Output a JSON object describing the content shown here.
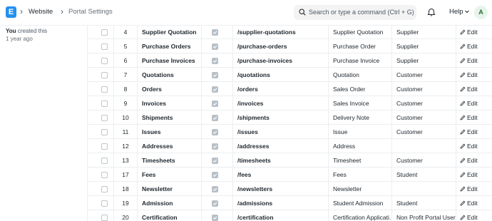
{
  "app": {
    "logo_letter": "E"
  },
  "breadcrumb": {
    "items": [
      "Website",
      "Portal Settings"
    ]
  },
  "search": {
    "placeholder": "Search or type a command (Ctrl + G)"
  },
  "header": {
    "help_label": "Help",
    "avatar_initial": "A"
  },
  "sidebar": {
    "actor": "You",
    "activity": "created this",
    "time": "1 year ago"
  },
  "table": {
    "edit_label": "Edit",
    "rows": [
      {
        "idx": "4",
        "title": "Supplier Quotation",
        "enabled": true,
        "route": "/supplier-quotations",
        "reference_doctype": "Supplier Quotation",
        "role": "Supplier"
      },
      {
        "idx": "5",
        "title": "Purchase Orders",
        "enabled": true,
        "route": "/purchase-orders",
        "reference_doctype": "Purchase Order",
        "role": "Supplier"
      },
      {
        "idx": "6",
        "title": "Purchase Invoices",
        "enabled": true,
        "route": "/purchase-invoices",
        "reference_doctype": "Purchase Invoice",
        "role": "Supplier"
      },
      {
        "idx": "7",
        "title": "Quotations",
        "enabled": true,
        "route": "/quotations",
        "reference_doctype": "Quotation",
        "role": "Customer"
      },
      {
        "idx": "8",
        "title": "Orders",
        "enabled": true,
        "route": "/orders",
        "reference_doctype": "Sales Order",
        "role": "Customer"
      },
      {
        "idx": "9",
        "title": "Invoices",
        "enabled": true,
        "route": "/invoices",
        "reference_doctype": "Sales Invoice",
        "role": "Customer"
      },
      {
        "idx": "10",
        "title": "Shipments",
        "enabled": true,
        "route": "/shipments",
        "reference_doctype": "Delivery Note",
        "role": "Customer"
      },
      {
        "idx": "11",
        "title": "Issues",
        "enabled": true,
        "route": "/issues",
        "reference_doctype": "Issue",
        "role": "Customer"
      },
      {
        "idx": "12",
        "title": "Addresses",
        "enabled": true,
        "route": "/addresses",
        "reference_doctype": "Address",
        "role": ""
      },
      {
        "idx": "13",
        "title": "Timesheets",
        "enabled": true,
        "route": "/timesheets",
        "reference_doctype": "Timesheet",
        "role": "Customer"
      },
      {
        "idx": "17",
        "title": "Fees",
        "enabled": true,
        "route": "/fees",
        "reference_doctype": "Fees",
        "role": "Student"
      },
      {
        "idx": "18",
        "title": "Newsletter",
        "enabled": true,
        "route": "/newsletters",
        "reference_doctype": "Newsletter",
        "role": ""
      },
      {
        "idx": "19",
        "title": "Admission",
        "enabled": true,
        "route": "/admissions",
        "reference_doctype": "Student Admission",
        "role": "Student"
      },
      {
        "idx": "20",
        "title": "Certification",
        "enabled": true,
        "route": "/certification",
        "reference_doctype": "Certification Applicati...",
        "role": "Non Profit Portal User"
      }
    ]
  },
  "colors": {
    "brand": "#2490ef",
    "checkbox_checked": "#b8c0c7",
    "border": "#ebeef0"
  }
}
